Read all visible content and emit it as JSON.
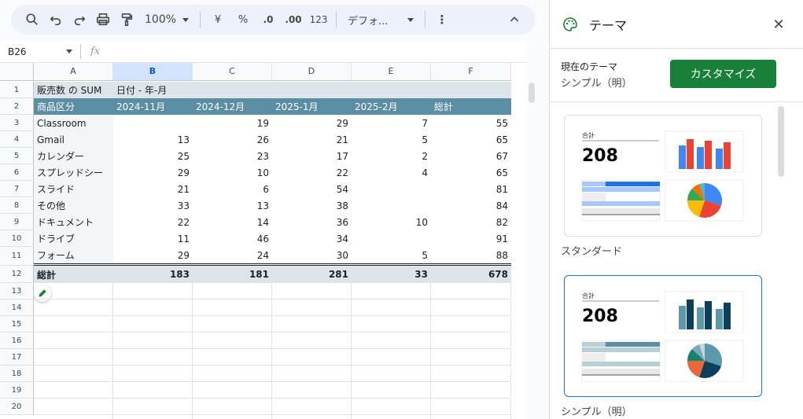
{
  "toolbar": {
    "zoom": "100%",
    "currency": "¥",
    "percent": "%",
    "dec_decrease": ".0",
    "dec_increase": ".00",
    "number_format": "123",
    "font": "デフォ..."
  },
  "formula_bar": {
    "cell_ref": "B26",
    "fx_symbol": "fx"
  },
  "sheet": {
    "columns": [
      "A",
      "B",
      "C",
      "D",
      "E",
      "F"
    ],
    "rows": [
      "1",
      "2",
      "3",
      "4",
      "5",
      "6",
      "7",
      "8",
      "9",
      "10",
      "11",
      "12",
      "13",
      "14",
      "15",
      "16",
      "17",
      "18",
      "19",
      "20"
    ],
    "pivot": {
      "title": "販売数 の SUM",
      "date_header": "日付 - 年-月",
      "category_header": "商品区分",
      "period_headers": [
        "2024-11月",
        "2024-12月",
        "2025-1月",
        "2025-2月",
        "総計"
      ],
      "data": [
        {
          "name": "Classroom",
          "values": [
            "",
            "19",
            "29",
            "7",
            "55"
          ]
        },
        {
          "name": "Gmail",
          "values": [
            "13",
            "26",
            "21",
            "5",
            "65"
          ]
        },
        {
          "name": "カレンダー",
          "values": [
            "25",
            "23",
            "17",
            "2",
            "67"
          ]
        },
        {
          "name": "スプレッドシー",
          "values": [
            "29",
            "10",
            "22",
            "4",
            "65"
          ]
        },
        {
          "name": "スライド",
          "values": [
            "21",
            "6",
            "54",
            "",
            "81"
          ]
        },
        {
          "name": "その他",
          "values": [
            "33",
            "13",
            "38",
            "",
            "84"
          ]
        },
        {
          "name": "ドキュメント",
          "values": [
            "22",
            "14",
            "36",
            "10",
            "82"
          ]
        },
        {
          "name": "ドライブ",
          "values": [
            "11",
            "46",
            "34",
            "",
            "91"
          ]
        },
        {
          "name": "フォーム",
          "values": [
            "29",
            "24",
            "30",
            "5",
            "88"
          ]
        }
      ],
      "total": {
        "name": "総計",
        "values": [
          "183",
          "181",
          "281",
          "33",
          "678"
        ]
      }
    }
  },
  "panel": {
    "title": "テーマ",
    "current_label": "現在のテーマ",
    "current_name": "シンプル（明）",
    "customize_label": "カスタマイズ",
    "themes": [
      {
        "name": "スタンダード",
        "card_label": "合計",
        "card_value": "208",
        "colors": {
          "bar1": "#ea4335",
          "bar2": "#4285f4",
          "table_dark": "#1a73e8",
          "table_light": "#a8c7fa"
        },
        "pie": [
          "#4285f4",
          "#ea4335",
          "#fbbc04",
          "#34a853",
          "#ff6d01",
          "#46bdc6"
        ]
      },
      {
        "name": "シンプル（明）",
        "card_label": "合計",
        "card_value": "208",
        "colors": {
          "bar1": "#0c3f5c",
          "bar2": "#5b99ac",
          "table_dark": "#5b8ea2",
          "table_light": "#b8cfd8"
        },
        "pie": [
          "#5b99ac",
          "#0c3f5c",
          "#e8683a",
          "#16856c",
          "#7ea8b8",
          "#c8d7dd"
        ]
      }
    ]
  }
}
